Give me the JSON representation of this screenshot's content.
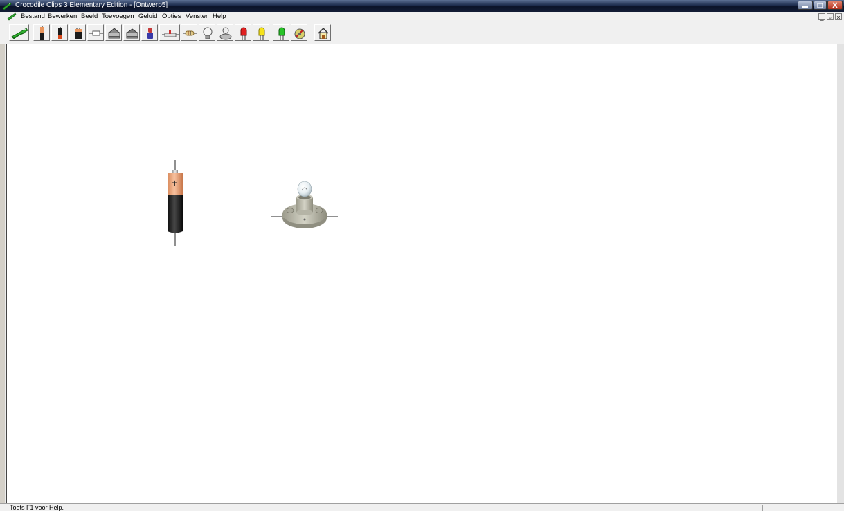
{
  "window": {
    "title": "Crocodile Clips 3 Elementary Edition - [Ontwerp5]"
  },
  "menu": {
    "items": [
      "Bestand",
      "Bewerken",
      "Beeld",
      "Toevoegen",
      "Geluid",
      "Opties",
      "Venster",
      "Help"
    ]
  },
  "toolbar": {
    "buttons": [
      {
        "icon": "crocodile-clip-icon"
      },
      {
        "icon": "battery-icon"
      },
      {
        "icon": "battery-small-icon"
      },
      {
        "icon": "battery-large-icon"
      },
      {
        "icon": "fuse-icon"
      },
      {
        "icon": "switch-icon"
      },
      {
        "icon": "switch-two-way-icon"
      },
      {
        "icon": "push-switch-icon"
      },
      {
        "icon": "slide-switch-icon"
      },
      {
        "icon": "resistor-icon"
      },
      {
        "icon": "lamp-icon"
      },
      {
        "icon": "lamp-holder-icon"
      },
      {
        "icon": "red-led-icon"
      },
      {
        "icon": "yellow-led-icon"
      },
      {
        "icon": "green-led-icon"
      },
      {
        "icon": "motor-icon"
      },
      {
        "icon": "home-icon"
      }
    ]
  },
  "canvas": {
    "components": [
      {
        "type": "battery",
        "label": "+"
      },
      {
        "type": "lamp"
      }
    ]
  },
  "status": {
    "text": "Toets F1 voor Help."
  }
}
